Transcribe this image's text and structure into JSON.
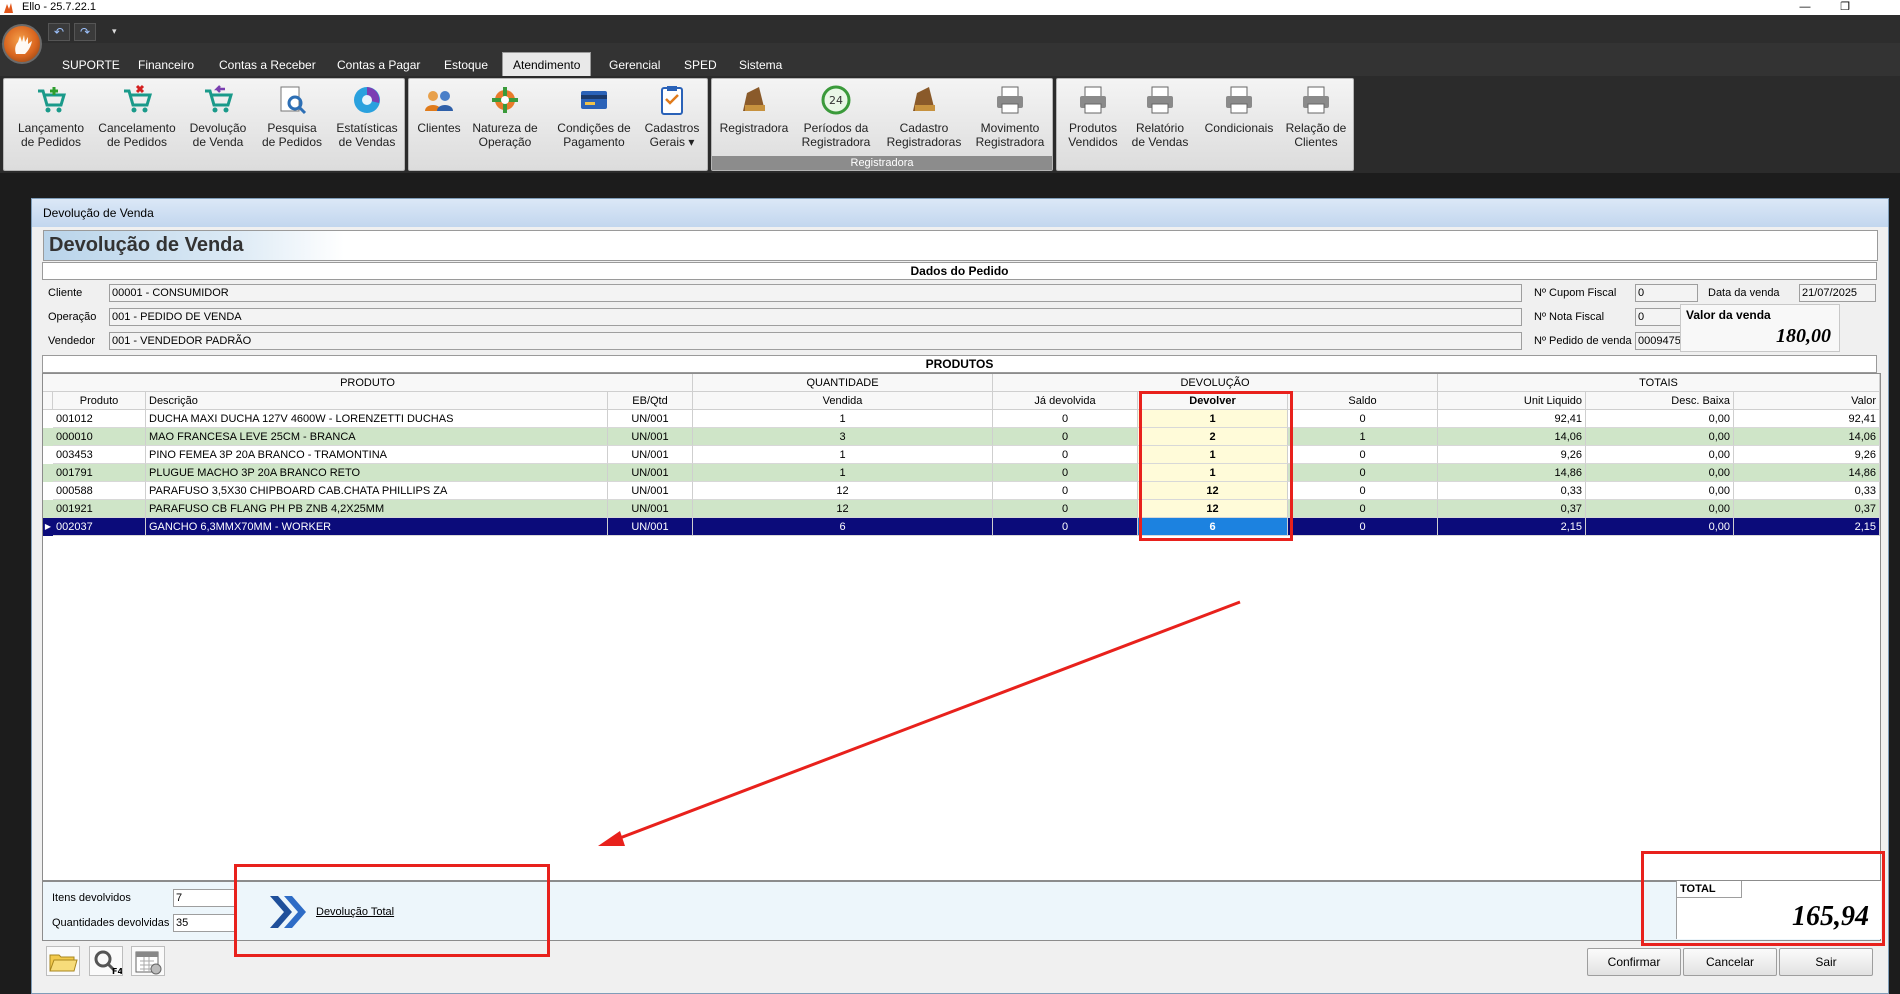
{
  "window": {
    "title": "Ello - 25.7.22.1",
    "minimize_glyph": "—",
    "restore_glyph": "❐"
  },
  "menu": {
    "tabs": [
      {
        "label": "SUPORTE",
        "active": false
      },
      {
        "label": "Financeiro",
        "active": false
      },
      {
        "label": "Contas a Receber",
        "active": false
      },
      {
        "label": "Contas a Pagar",
        "active": false
      },
      {
        "label": "Estoque",
        "active": false
      },
      {
        "label": "Atendimento",
        "active": true
      },
      {
        "label": "Gerencial",
        "active": false
      },
      {
        "label": "SPED",
        "active": false
      },
      {
        "label": "Sistema",
        "active": false
      }
    ]
  },
  "ribbon": {
    "group1": [
      {
        "label1": "Lançamento",
        "label2": "de Pedidos",
        "icon": "cart-add-icon"
      },
      {
        "label1": "Cancelamento",
        "label2": "de Pedidos",
        "icon": "cart-cancel-icon"
      },
      {
        "label1": "Devolução",
        "label2": "de Venda",
        "icon": "cart-return-icon"
      },
      {
        "label1": "Pesquisa",
        "label2": "de Pedidos",
        "icon": "search-document-icon"
      },
      {
        "label1": "Estatísticas",
        "label2": "de Vendas",
        "icon": "statistics-icon"
      }
    ],
    "group2": [
      {
        "label1": "Clientes",
        "label2": "",
        "icon": "people-icon"
      },
      {
        "label1": "Natureza de",
        "label2": "Operação",
        "icon": "operation-icon"
      },
      {
        "label1": "Condições de",
        "label2": "Pagamento",
        "icon": "credit-card-icon"
      },
      {
        "label1": "Cadastros",
        "label2": "Gerais ▾",
        "icon": "clipboard-icon"
      }
    ],
    "group3": [
      {
        "label1": "Registradora",
        "label2": "",
        "icon": "cash-register-icon"
      },
      {
        "label1": "Períodos da",
        "label2": "Registradora",
        "icon": "clock-24-icon"
      },
      {
        "label1": "Cadastro",
        "label2": "Registradoras",
        "icon": "cash-register-icon"
      },
      {
        "label1": "Movimento",
        "label2": "Registradora",
        "icon": "printer-icon"
      }
    ],
    "group3_caption": "Registradora",
    "group4": [
      {
        "label1": "Produtos",
        "label2": "Vendidos",
        "icon": "printer-icon"
      },
      {
        "label1": "Relatório",
        "label2": "de Vendas",
        "icon": "printer-icon"
      },
      {
        "label1": "Condicionais",
        "label2": "",
        "icon": "printer-icon"
      },
      {
        "label1": "Relação de",
        "label2": "Clientes",
        "icon": "printer-icon"
      }
    ]
  },
  "form": {
    "window_title": "Devolução de Venda",
    "page_title": "Devolução de Venda",
    "section_pedido": "Dados do Pedido",
    "cliente_label": "Cliente",
    "cliente_value": "00001 - CONSUMIDOR",
    "operacao_label": "Operação",
    "operacao_value": "001 - PEDIDO DE VENDA",
    "vendedor_label": "Vendedor",
    "vendedor_value": "001 - VENDEDOR PADRÃO",
    "cupom_label": "Nº Cupom Fiscal",
    "cupom_value": "0",
    "nota_label": "Nº Nota Fiscal",
    "nota_value": "0",
    "pedido_label": "Nº Pedido de venda",
    "pedido_value": "0009475",
    "data_label": "Data da venda",
    "data_value": "21/07/2025",
    "valor_label": "Valor da venda",
    "valor_value": "180,00",
    "section_produtos": "PRODUTOS"
  },
  "grid": {
    "groups": {
      "produto": "PRODUTO",
      "quantidade": "QUANTIDADE",
      "devolucao": "DEVOLUÇÃO",
      "totais": "TOTAIS"
    },
    "columns": {
      "produto": "Produto",
      "descricao": "Descrição",
      "ebqtd": "EB/Qtd",
      "vendida": "Vendida",
      "ja_devolvida": "Já devolvida",
      "devolver": "Devolver",
      "saldo": "Saldo",
      "unit": "Unit Liquido",
      "desc": "Desc. Baixa",
      "valor": "Valor"
    },
    "rows": [
      {
        "produto": "001012",
        "descricao": "DUCHA MAXI DUCHA 127V 4600W - LORENZETTI DUCHAS",
        "eb": "UN/001",
        "vendida": "1",
        "ja": "0",
        "devolver": "1",
        "saldo": "0",
        "unit": "92,41",
        "desc": "0,00",
        "valor": "92,41"
      },
      {
        "produto": "000010",
        "descricao": "MAO FRANCESA LEVE 25CM - BRANCA",
        "eb": "UN/001",
        "vendida": "3",
        "ja": "0",
        "devolver": "2",
        "saldo": "1",
        "unit": "14,06",
        "desc": "0,00",
        "valor": "14,06"
      },
      {
        "produto": "003453",
        "descricao": "PINO FEMEA 3P 20A BRANCO - TRAMONTINA",
        "eb": "UN/001",
        "vendida": "1",
        "ja": "0",
        "devolver": "1",
        "saldo": "0",
        "unit": "9,26",
        "desc": "0,00",
        "valor": "9,26"
      },
      {
        "produto": "001791",
        "descricao": "PLUGUE MACHO 3P 20A BRANCO RETO",
        "eb": "UN/001",
        "vendida": "1",
        "ja": "0",
        "devolver": "1",
        "saldo": "0",
        "unit": "14,86",
        "desc": "0,00",
        "valor": "14,86"
      },
      {
        "produto": "000588",
        "descricao": "PARAFUSO 3,5X30 CHIPBOARD CAB.CHATA PHILLIPS ZA",
        "eb": "UN/001",
        "vendida": "12",
        "ja": "0",
        "devolver": "12",
        "saldo": "0",
        "unit": "0,33",
        "desc": "0,00",
        "valor": "0,33"
      },
      {
        "produto": "001921",
        "descricao": "PARAFUSO CB FLANG PH PB ZNB 4,2X25MM",
        "eb": "UN/001",
        "vendida": "12",
        "ja": "0",
        "devolver": "12",
        "saldo": "0",
        "unit": "0,37",
        "desc": "0,00",
        "valor": "0,37"
      },
      {
        "produto": "002037",
        "descricao": "GANCHO 6,3MMX70MM - WORKER",
        "eb": "UN/001",
        "vendida": "6",
        "ja": "0",
        "devolver": "6",
        "saldo": "0",
        "unit": "2,15",
        "desc": "0,00",
        "valor": "2,15"
      }
    ],
    "selected_row_index": 6,
    "row_indicator": "▶"
  },
  "footer": {
    "itens_label": "Itens devolvidos",
    "itens_value": "7",
    "qtd_label": "Quantidades devolvidas",
    "qtd_value": "35",
    "devolucao_total_label": "Devolução Total",
    "total_label": "TOTAL",
    "total_value": "165,94"
  },
  "buttons": {
    "confirmar": "Confirmar",
    "cancelar": "Cancelar",
    "sair": "Sair"
  },
  "toolbar_icons": [
    "folder-open-icon",
    "search-f4-icon",
    "calendar-icon"
  ],
  "colors": {
    "annotation_red": "#e8211c",
    "alt_row_green": "#cfe5c8",
    "selected_row": "#0b0b7a",
    "devolver_cell": "#fffbd9"
  }
}
